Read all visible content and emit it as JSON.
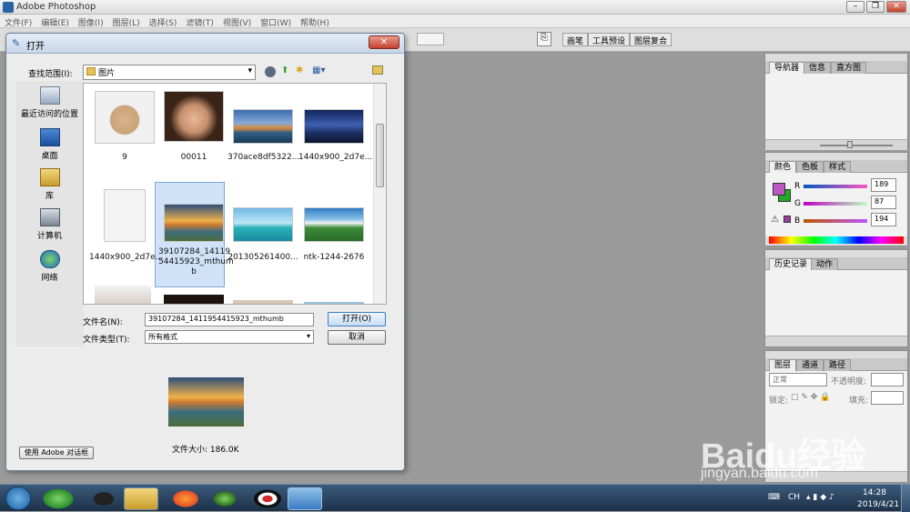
{
  "app": {
    "title": "Adobe Photoshop",
    "menus": [
      "文件(F)",
      "编辑(E)",
      "图像(I)",
      "图层(L)",
      "选择(S)",
      "滤镜(T)",
      "视图(V)",
      "窗口(W)",
      "帮助(H)"
    ],
    "dock": [
      "画笔",
      "工具预设",
      "图层复合"
    ]
  },
  "dialog": {
    "title": "打开",
    "lookin_label": "查找范围(I):",
    "lookin_value": "图片",
    "places": [
      "最近访问的位置",
      "桌面",
      "库",
      "计算机",
      "网络"
    ],
    "files": [
      "9",
      "00011",
      "370ace8df5322...",
      "1440x900_2d7e...",
      "1440x900_2d7e...",
      "39107284_14119\n54415923_mthum\nb",
      "201305261400...",
      "ntk-1244-2676"
    ],
    "filename_label": "文件名(N):",
    "filename_value": "39107284_1411954415923_mthumb",
    "filetype_label": "文件类型(T):",
    "filetype_value": "所有格式",
    "open_btn": "打开(O)",
    "cancel_btn": "取消",
    "filesize": "文件大小: 186.0K",
    "adobe_btn": "使用 Adobe 对话框"
  },
  "panels": {
    "nav_tabs": [
      "导航器",
      "信息",
      "直方图"
    ],
    "color_tabs": [
      "颜色",
      "色板",
      "样式"
    ],
    "rgb": [
      {
        "ch": "R",
        "val": "189"
      },
      {
        "ch": "G",
        "val": "87"
      },
      {
        "ch": "B",
        "val": "194"
      }
    ],
    "history_tabs": [
      "历史记录",
      "动作"
    ],
    "layer_tabs": [
      "图层",
      "通道",
      "路径"
    ],
    "blend": "正常",
    "opacity_label": "不透明度:",
    "lock_label": "锁定:",
    "fill_label": "填充:"
  },
  "taskbar": {
    "lang": "CH",
    "time": "14:28",
    "date": "2019/4/21"
  },
  "watermark": {
    "brand": "Baidu经验",
    "url": "jingyan.baidu.com"
  },
  "colors": {
    "fg": "#bd57c2",
    "bg": "#22aa22"
  }
}
